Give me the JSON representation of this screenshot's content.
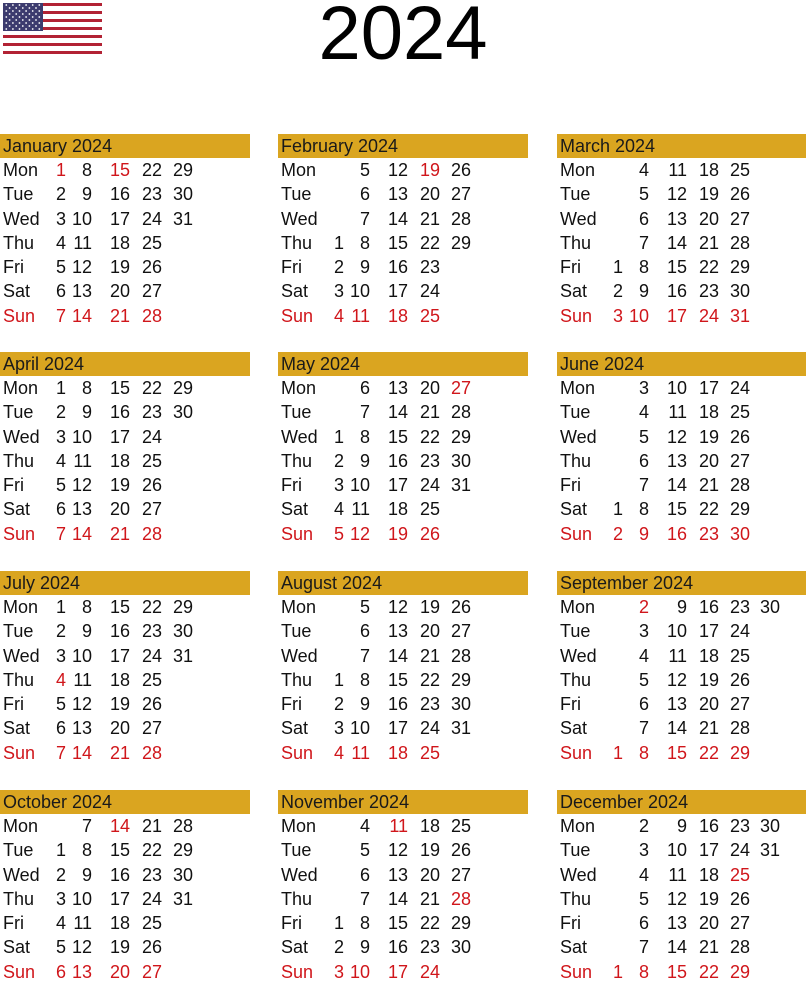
{
  "title": "2024",
  "flag": {
    "icon": "us-flag-icon",
    "colors": {
      "red": "#B22234",
      "white": "#FFFFFF",
      "blue": "#3C3B6E"
    }
  },
  "colors": {
    "header_bg": "#DAA520",
    "holiday": "#D0161B",
    "text": "#111111"
  },
  "weekdays": [
    "Mon",
    "Tue",
    "Wed",
    "Thu",
    "Fri",
    "Sat",
    "Sun"
  ],
  "months": [
    {
      "name": "January 2024",
      "rows": [
        [
          "1",
          "8",
          "15",
          "22",
          "29"
        ],
        [
          "2",
          "9",
          "16",
          "23",
          "30"
        ],
        [
          "3",
          "10",
          "17",
          "24",
          "31"
        ],
        [
          "4",
          "11",
          "18",
          "25",
          ""
        ],
        [
          "5",
          "12",
          "19",
          "26",
          ""
        ],
        [
          "6",
          "13",
          "20",
          "27",
          ""
        ],
        [
          "7",
          "14",
          "21",
          "28",
          ""
        ]
      ],
      "holidays": [
        "1",
        "15"
      ]
    },
    {
      "name": "February 2024",
      "rows": [
        [
          "",
          "5",
          "12",
          "19",
          "26"
        ],
        [
          "",
          "6",
          "13",
          "20",
          "27"
        ],
        [
          "",
          "7",
          "14",
          "21",
          "28"
        ],
        [
          "1",
          "8",
          "15",
          "22",
          "29"
        ],
        [
          "2",
          "9",
          "16",
          "23",
          ""
        ],
        [
          "3",
          "10",
          "17",
          "24",
          ""
        ],
        [
          "4",
          "11",
          "18",
          "25",
          ""
        ]
      ],
      "holidays": [
        "19"
      ]
    },
    {
      "name": "March 2024",
      "rows": [
        [
          "",
          "4",
          "11",
          "18",
          "25"
        ],
        [
          "",
          "5",
          "12",
          "19",
          "26"
        ],
        [
          "",
          "6",
          "13",
          "20",
          "27"
        ],
        [
          "",
          "7",
          "14",
          "21",
          "28"
        ],
        [
          "1",
          "8",
          "15",
          "22",
          "29"
        ],
        [
          "2",
          "9",
          "16",
          "23",
          "30"
        ],
        [
          "3",
          "10",
          "17",
          "24",
          "31"
        ]
      ],
      "holidays": []
    },
    {
      "name": "April 2024",
      "rows": [
        [
          "1",
          "8",
          "15",
          "22",
          "29"
        ],
        [
          "2",
          "9",
          "16",
          "23",
          "30"
        ],
        [
          "3",
          "10",
          "17",
          "24",
          ""
        ],
        [
          "4",
          "11",
          "18",
          "25",
          ""
        ],
        [
          "5",
          "12",
          "19",
          "26",
          ""
        ],
        [
          "6",
          "13",
          "20",
          "27",
          ""
        ],
        [
          "7",
          "14",
          "21",
          "28",
          ""
        ]
      ],
      "holidays": []
    },
    {
      "name": "May 2024",
      "rows": [
        [
          "",
          "6",
          "13",
          "20",
          "27"
        ],
        [
          "",
          "7",
          "14",
          "21",
          "28"
        ],
        [
          "1",
          "8",
          "15",
          "22",
          "29"
        ],
        [
          "2",
          "9",
          "16",
          "23",
          "30"
        ],
        [
          "3",
          "10",
          "17",
          "24",
          "31"
        ],
        [
          "4",
          "11",
          "18",
          "25",
          ""
        ],
        [
          "5",
          "12",
          "19",
          "26",
          ""
        ]
      ],
      "holidays": [
        "27"
      ]
    },
    {
      "name": "June 2024",
      "rows": [
        [
          "",
          "3",
          "10",
          "17",
          "24"
        ],
        [
          "",
          "4",
          "11",
          "18",
          "25"
        ],
        [
          "",
          "5",
          "12",
          "19",
          "26"
        ],
        [
          "",
          "6",
          "13",
          "20",
          "27"
        ],
        [
          "",
          "7",
          "14",
          "21",
          "28"
        ],
        [
          "1",
          "8",
          "15",
          "22",
          "29"
        ],
        [
          "2",
          "9",
          "16",
          "23",
          "30"
        ]
      ],
      "holidays": []
    },
    {
      "name": "July 2024",
      "rows": [
        [
          "1",
          "8",
          "15",
          "22",
          "29"
        ],
        [
          "2",
          "9",
          "16",
          "23",
          "30"
        ],
        [
          "3",
          "10",
          "17",
          "24",
          "31"
        ],
        [
          "4",
          "11",
          "18",
          "25",
          ""
        ],
        [
          "5",
          "12",
          "19",
          "26",
          ""
        ],
        [
          "6",
          "13",
          "20",
          "27",
          ""
        ],
        [
          "7",
          "14",
          "21",
          "28",
          ""
        ]
      ],
      "holidays": [
        "4"
      ]
    },
    {
      "name": "August 2024",
      "rows": [
        [
          "",
          "5",
          "12",
          "19",
          "26"
        ],
        [
          "",
          "6",
          "13",
          "20",
          "27"
        ],
        [
          "",
          "7",
          "14",
          "21",
          "28"
        ],
        [
          "1",
          "8",
          "15",
          "22",
          "29"
        ],
        [
          "2",
          "9",
          "16",
          "23",
          "30"
        ],
        [
          "3",
          "10",
          "17",
          "24",
          "31"
        ],
        [
          "4",
          "11",
          "18",
          "25",
          ""
        ]
      ],
      "holidays": []
    },
    {
      "name": "September 2024",
      "rows": [
        [
          "",
          "2",
          "9",
          "16",
          "23",
          "30"
        ],
        [
          "",
          "3",
          "10",
          "17",
          "24",
          ""
        ],
        [
          "",
          "4",
          "11",
          "18",
          "25",
          ""
        ],
        [
          "",
          "5",
          "12",
          "19",
          "26",
          ""
        ],
        [
          "",
          "6",
          "13",
          "20",
          "27",
          ""
        ],
        [
          "",
          "7",
          "14",
          "21",
          "28",
          ""
        ],
        [
          "1",
          "8",
          "15",
          "22",
          "29",
          ""
        ]
      ],
      "holidays": [
        "2"
      ]
    },
    {
      "name": "October 2024",
      "rows": [
        [
          "",
          "7",
          "14",
          "21",
          "28"
        ],
        [
          "1",
          "8",
          "15",
          "22",
          "29"
        ],
        [
          "2",
          "9",
          "16",
          "23",
          "30"
        ],
        [
          "3",
          "10",
          "17",
          "24",
          "31"
        ],
        [
          "4",
          "11",
          "18",
          "25",
          ""
        ],
        [
          "5",
          "12",
          "19",
          "26",
          ""
        ],
        [
          "6",
          "13",
          "20",
          "27",
          ""
        ]
      ],
      "holidays": [
        "14"
      ]
    },
    {
      "name": "November 2024",
      "rows": [
        [
          "",
          "4",
          "11",
          "18",
          "25"
        ],
        [
          "",
          "5",
          "12",
          "19",
          "26"
        ],
        [
          "",
          "6",
          "13",
          "20",
          "27"
        ],
        [
          "",
          "7",
          "14",
          "21",
          "28"
        ],
        [
          "1",
          "8",
          "15",
          "22",
          "29"
        ],
        [
          "2",
          "9",
          "16",
          "23",
          "30"
        ],
        [
          "3",
          "10",
          "17",
          "24",
          ""
        ]
      ],
      "holidays": [
        "11",
        "28"
      ]
    },
    {
      "name": "December 2024",
      "rows": [
        [
          "",
          "2",
          "9",
          "16",
          "23",
          "30"
        ],
        [
          "",
          "3",
          "10",
          "17",
          "24",
          "31"
        ],
        [
          "",
          "4",
          "11",
          "18",
          "25",
          ""
        ],
        [
          "",
          "5",
          "12",
          "19",
          "26",
          ""
        ],
        [
          "",
          "6",
          "13",
          "20",
          "27",
          ""
        ],
        [
          "",
          "7",
          "14",
          "21",
          "28",
          ""
        ],
        [
          "1",
          "8",
          "15",
          "22",
          "29",
          ""
        ]
      ],
      "holidays": [
        "25"
      ]
    }
  ]
}
